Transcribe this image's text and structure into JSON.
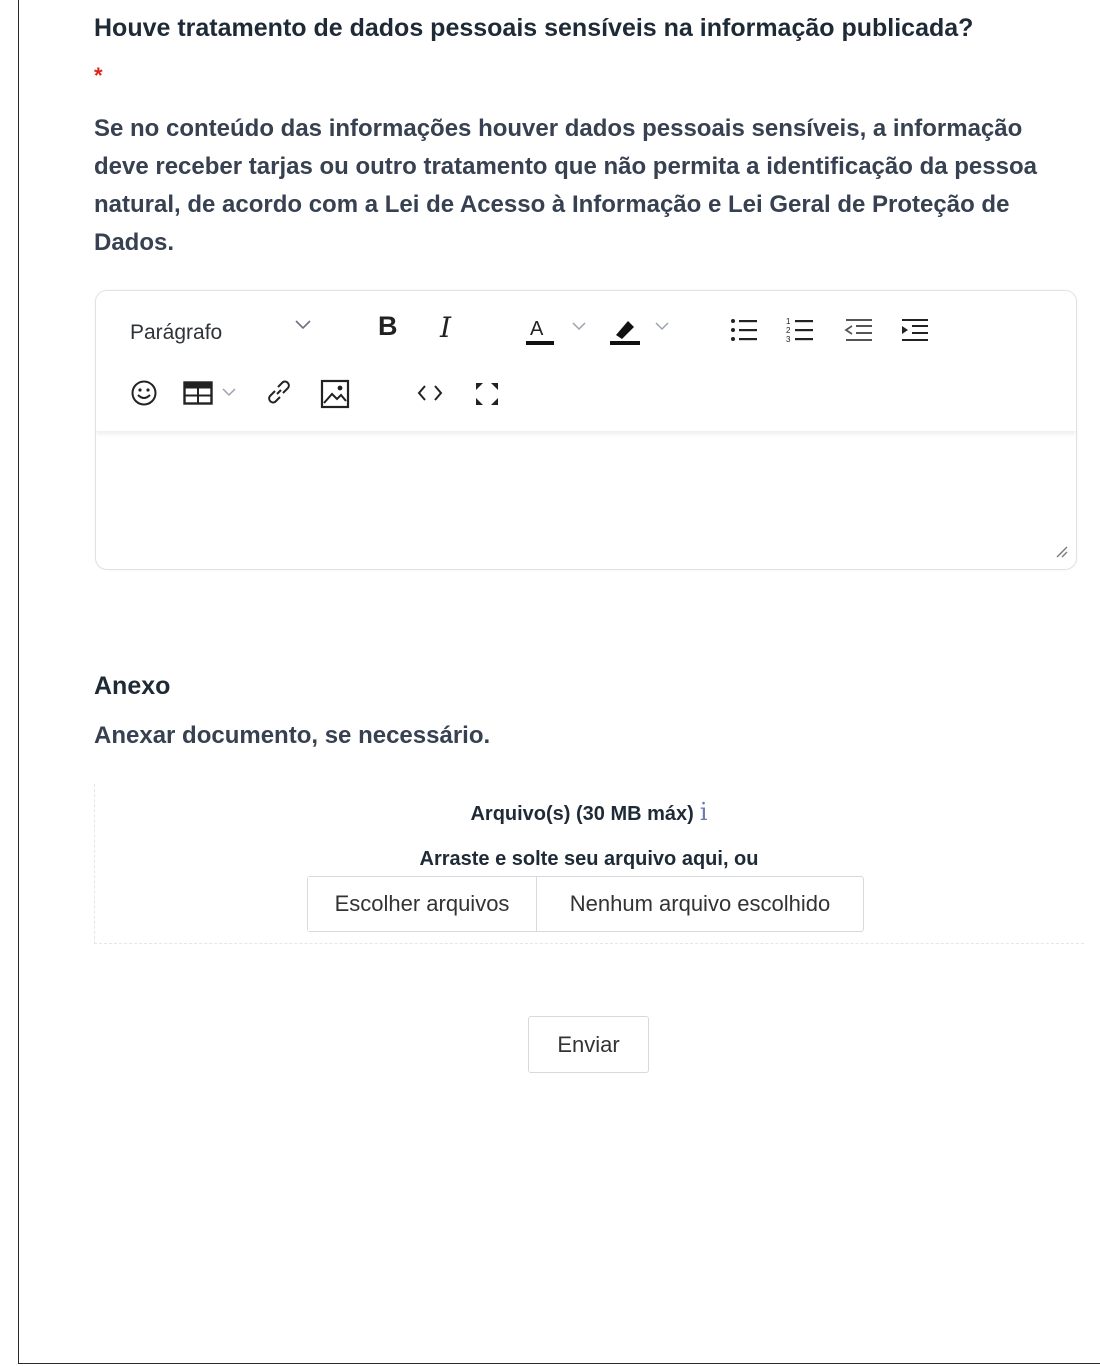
{
  "question": {
    "title": "Houve tratamento de dados pessoais sensíveis na informação publicada?",
    "required_mark": "*",
    "help_text": "Se no conteúdo das informações houver dados pessoais sensíveis, a informação deve receber tarjas ou outro tratamento que não permita a identificação da pessoa natural, de acordo com a Lei de Acesso à Informação e Lei Geral de Proteção de Dados."
  },
  "editor": {
    "paragraph_select": "Parágrafo",
    "toolbar_icons": [
      "chevron-down-icon",
      "bold-icon",
      "italic-icon",
      "font-color-icon",
      "highlight-icon",
      "bulleted-list-icon",
      "numbered-list-icon",
      "outdent-icon",
      "indent-icon",
      "emoji-icon",
      "table-icon",
      "link-icon",
      "image-icon",
      "source-code-icon",
      "fullscreen-icon",
      "resize-handle-icon"
    ],
    "content": ""
  },
  "attachment": {
    "title": "Anexo",
    "help_text": "Anexar documento, se necessário.",
    "files_label": "Arquivo(s) (30 MB máx)",
    "info_icon": "i",
    "drag_text": "Arraste e solte seu arquivo aqui, ou",
    "choose_button": "Escolher arquivos",
    "no_file_text": "Nenhum arquivo escolhido"
  },
  "submit_label": "Enviar",
  "colors": {
    "text": "#1f2a37",
    "required": "#e0231b",
    "info_icon": "#6b7bb3",
    "border": "#d6d9dd"
  }
}
